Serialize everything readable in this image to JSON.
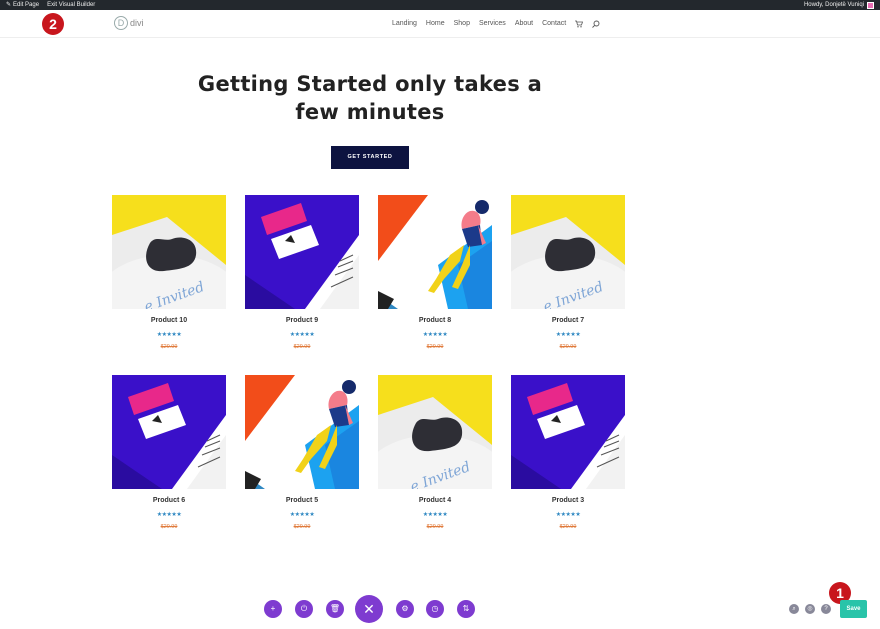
{
  "adminbar": {
    "edit_page": "Edit Page",
    "exit_vb": "Exit Visual Builder",
    "greeting": "Howdy, Donjetë Vuniqi"
  },
  "markers": {
    "one": "1",
    "two": "2"
  },
  "logo": {
    "mark": "D",
    "word": "divi"
  },
  "nav": [
    "Landing",
    "Home",
    "Shop",
    "Services",
    "About",
    "Contact"
  ],
  "hero": {
    "headline_line1": "Getting Started only takes a",
    "headline_line2": "few minutes",
    "cta": "GET STARTED"
  },
  "products": [
    {
      "name": "Product 10",
      "rating": "★★★★★",
      "price": "$29.99",
      "art": "invite"
    },
    {
      "name": "Product 9",
      "rating": "★★★★★",
      "price": "$29.99",
      "art": "card"
    },
    {
      "name": "Product 8",
      "rating": "★★★★★",
      "price": "$29.99",
      "art": "woman"
    },
    {
      "name": "Product 7",
      "rating": "★★★★★",
      "price": "$29.99",
      "art": "invite"
    },
    {
      "name": "Product 6",
      "rating": "★★★★★",
      "price": "$29.99",
      "art": "card"
    },
    {
      "name": "Product 5",
      "rating": "★★★★★",
      "price": "$29.99",
      "art": "woman"
    },
    {
      "name": "Product 4",
      "rating": "★★★★★",
      "price": "$29.99",
      "art": "invite"
    },
    {
      "name": "Product 3",
      "rating": "★★★★★",
      "price": "$29.99",
      "art": "card"
    }
  ],
  "builder": {
    "save": "Save",
    "tools": [
      "add-icon",
      "power-icon",
      "trash-icon",
      "close-icon",
      "gear-icon",
      "history-icon",
      "sort-icon"
    ],
    "right_tools": [
      "zoom-icon",
      "settings-icon",
      "help-icon"
    ]
  },
  "colors": {
    "admin_bg": "#23282d",
    "cta_bg": "#0d1340",
    "builder_purple": "#7e3bd0",
    "save_green": "#29c4a9",
    "star_blue": "#2f88c2",
    "price_orange": "#e07b3c",
    "marker_red": "#c8161d"
  }
}
